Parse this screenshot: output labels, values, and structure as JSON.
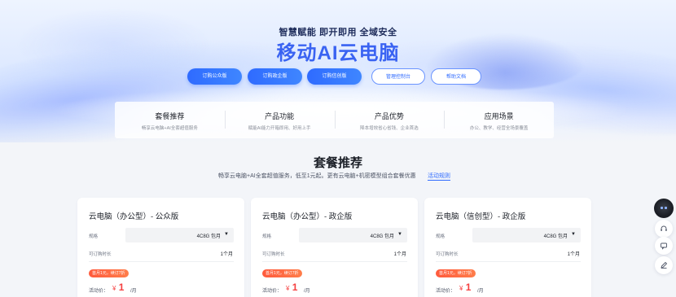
{
  "hero": {
    "subtitle": "智慧赋能 即开即用 全域安全",
    "title": "移动AI云电脑",
    "buttons": [
      {
        "label": "订购公众版"
      },
      {
        "label": "订购政企版"
      },
      {
        "label": "订购信创版"
      },
      {
        "label": "管理控制台"
      },
      {
        "label": "帮助文档"
      }
    ]
  },
  "tabs": [
    {
      "title": "套餐推荐",
      "desc": "畅享云电脑+AI全套超值服务"
    },
    {
      "title": "产品功能",
      "desc": "赋能AI能力开箱即用、好用上手"
    },
    {
      "title": "产品优势",
      "desc": "降本增效省心省钱、企业首选"
    },
    {
      "title": "应用场景",
      "desc": "办公、教学、经营全场景覆盖"
    }
  ],
  "section": {
    "title": "套餐推荐",
    "desc": "畅享云电脑+AI全套超值服务，低至1元起。更有云电脑+机密模型组合套餐优惠",
    "link": "活动规则"
  },
  "cards": [
    {
      "title": "云电脑（办公型）- 公众版",
      "spec_label": "规格",
      "spec_value": "4C8G 包月",
      "duration_label": "可订购时长",
      "duration_value": "1个月",
      "promo": "首月1元，续订7折",
      "price_label": "活动价：",
      "currency": "¥",
      "price": "1",
      "unit": "/月"
    },
    {
      "title": "云电脑（办公型）- 政企版",
      "spec_label": "规格",
      "spec_value": "4C8G 包月",
      "duration_label": "可订购时长",
      "duration_value": "1个月",
      "promo": "首月1元，续订7折",
      "price_label": "活动价：",
      "currency": "¥",
      "price": "1",
      "unit": "/月"
    },
    {
      "title": "云电脑（信创型）- 政企版",
      "spec_label": "规格",
      "spec_value": "4C8G 包月",
      "duration_label": "可订购时长",
      "duration_value": "1个月",
      "promo": "首月1元，续订7折",
      "price_label": "活动价：",
      "currency": "¥",
      "price": "1",
      "unit": "/月"
    }
  ],
  "float_toolbar": {
    "icons": [
      "ai-assistant-robot-icon",
      "customer-service-headset-icon",
      "chat-message-icon",
      "feedback-edit-icon"
    ]
  },
  "colors": {
    "brand": "#2f6bff",
    "title": "#3a63f2",
    "price": "#f53f3f",
    "promo": "#ff5a3c"
  }
}
